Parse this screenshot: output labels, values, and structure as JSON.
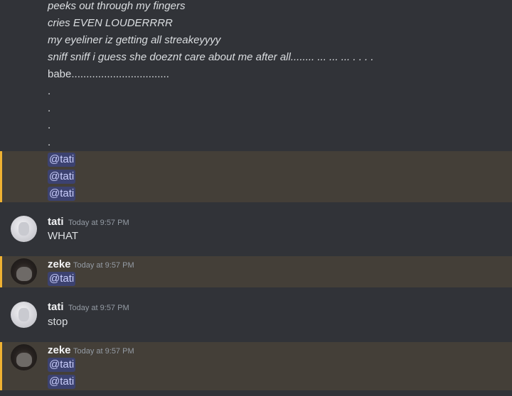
{
  "top_lines": [
    {
      "text": "peeks out through my fingers",
      "italic": true
    },
    {
      "text": "cries EVEN LOUDERRRR",
      "italic": true
    },
    {
      "text": "my eyeliner iz getting all streakeyyyy",
      "italic": true
    },
    {
      "text": "sniff sniff i guess she doeznt care about me after all........ ... ... ... . . . .",
      "italic": true
    },
    {
      "text": "babe.................................",
      "italic": false
    },
    {
      "text": ".",
      "italic": false
    },
    {
      "text": ".",
      "italic": false
    },
    {
      "text": ".",
      "italic": false
    },
    {
      "text": ".",
      "italic": false
    }
  ],
  "mention_block": [
    "@tati",
    "@tati",
    "@tati"
  ],
  "messages": [
    {
      "author": "tati",
      "time": "Today at 9:57 PM",
      "lines": [
        "WHAT"
      ]
    },
    {
      "author": "zeke",
      "time": "Today at 9:57 PM",
      "mentions": [
        "@tati"
      ]
    },
    {
      "author": "tati",
      "time": "Today at 9:57 PM",
      "lines": [
        "stop"
      ]
    },
    {
      "author": "zeke",
      "time": "Today at 9:57 PM",
      "mentions": [
        "@tati",
        "@tati"
      ]
    }
  ],
  "colors": {
    "background": "#313338",
    "highlight": "#443f38",
    "highlight_bar": "#f0b232",
    "mention_bg": "#3c4270",
    "mention_text": "#c9cdfb"
  }
}
